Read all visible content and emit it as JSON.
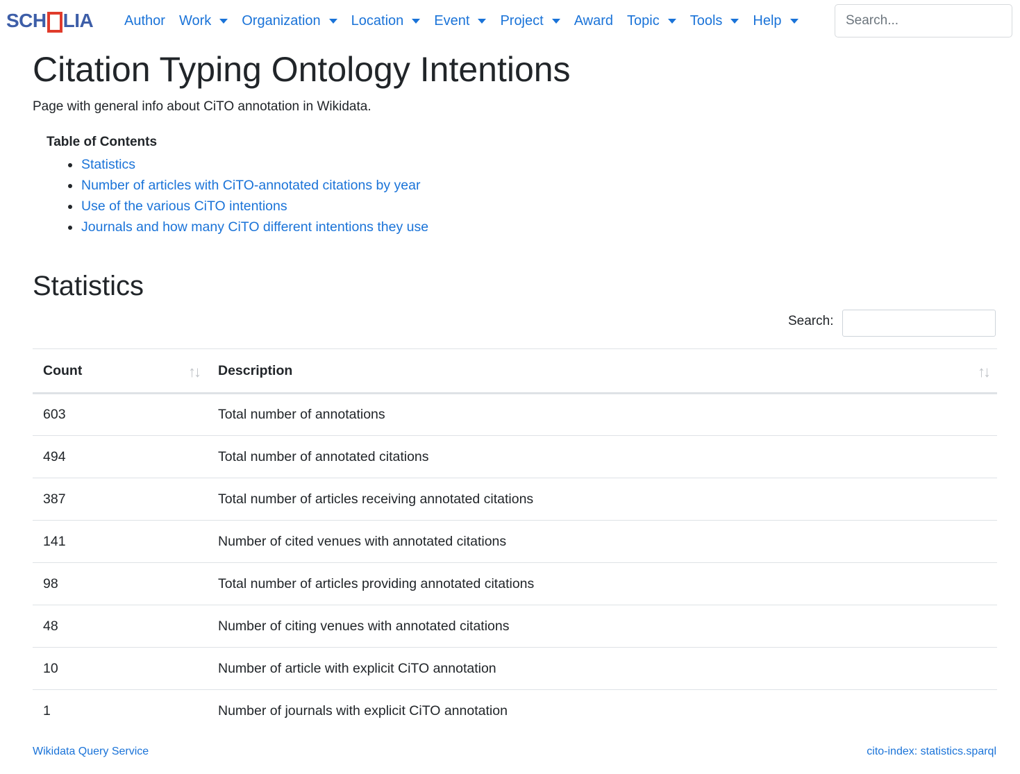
{
  "brand": {
    "left": "SCH",
    "right": "LIA"
  },
  "nav": {
    "items": [
      {
        "label": "Author",
        "dropdown": false
      },
      {
        "label": "Work",
        "dropdown": true
      },
      {
        "label": "Organization",
        "dropdown": true
      },
      {
        "label": "Location",
        "dropdown": true
      },
      {
        "label": "Event",
        "dropdown": true
      },
      {
        "label": "Project",
        "dropdown": true
      },
      {
        "label": "Award",
        "dropdown": false
      },
      {
        "label": "Topic",
        "dropdown": true
      },
      {
        "label": "Tools",
        "dropdown": true
      },
      {
        "label": "Help",
        "dropdown": true
      }
    ],
    "search_placeholder": "Search..."
  },
  "page": {
    "title": "Citation Typing Ontology Intentions",
    "lead": "Page with general info about CiTO annotation in Wikidata."
  },
  "toc": {
    "title": "Table of Contents",
    "items": [
      "Statistics",
      "Number of articles with CiTO-annotated citations by year",
      "Use of the various CiTO intentions",
      "Journals and how many CiTO different intentions they use"
    ]
  },
  "statistics": {
    "title": "Statistics",
    "search_label": "Search:",
    "columns": [
      "Count",
      "Description"
    ],
    "rows": [
      {
        "count": "603",
        "description": "Total number of annotations"
      },
      {
        "count": "494",
        "description": "Total number of annotated citations"
      },
      {
        "count": "387",
        "description": "Total number of articles receiving annotated citations"
      },
      {
        "count": "141",
        "description": "Number of cited venues with annotated citations"
      },
      {
        "count": "98",
        "description": "Total number of articles providing annotated citations"
      },
      {
        "count": "48",
        "description": "Number of citing venues with annotated citations"
      },
      {
        "count": "10",
        "description": "Number of article with explicit CiTO annotation"
      },
      {
        "count": "1",
        "description": "Number of journals with explicit CiTO annotation"
      }
    ]
  },
  "footer": {
    "left_link": "Wikidata Query Service",
    "right_link": "cito-index: statistics.sparql"
  },
  "colors": {
    "link": "#1a73d8",
    "brand_blue": "#3d5ea8",
    "brand_red": "#e03b2b"
  }
}
